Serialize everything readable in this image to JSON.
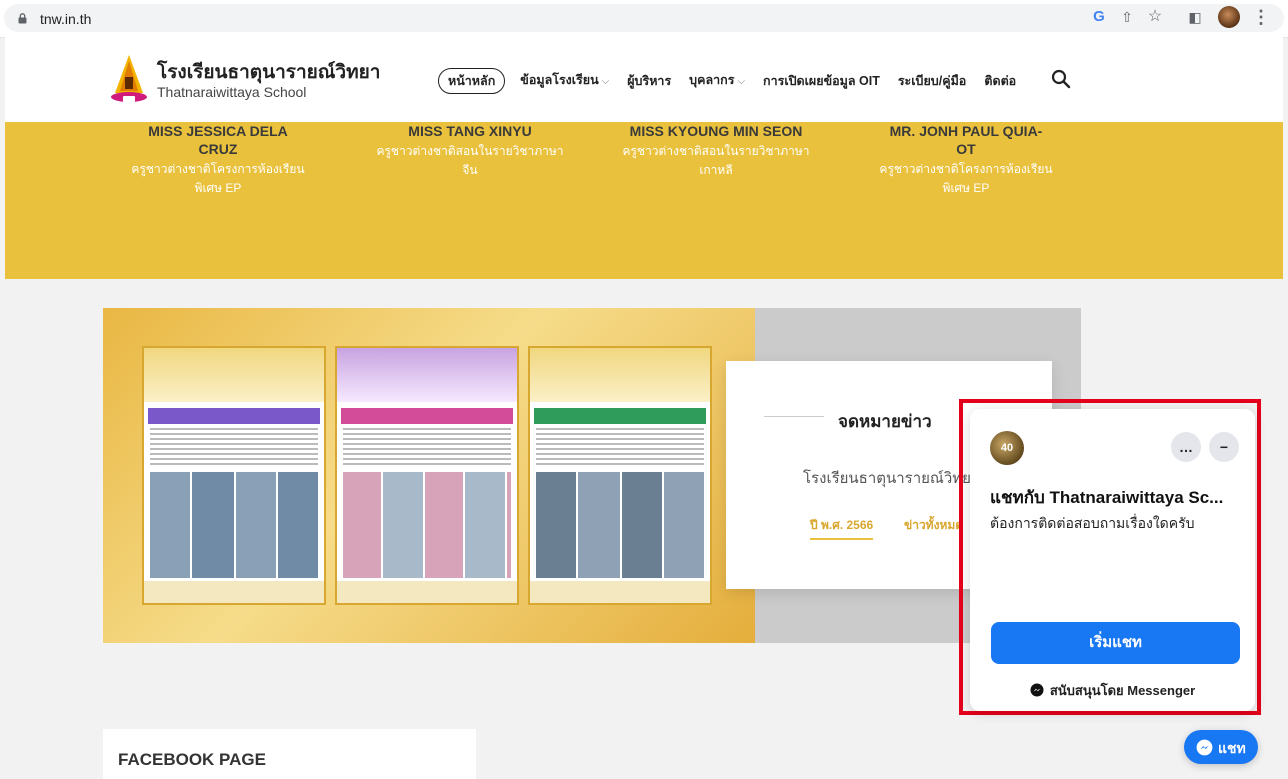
{
  "browser": {
    "url": "tnw.in.th",
    "icons": [
      "lock-icon",
      "google-icon",
      "share-icon",
      "star-icon",
      "sidebar-icon",
      "profile-avatar",
      "kebab-icon"
    ]
  },
  "header": {
    "school_th": "โรงเรียนธาตุนารายณ์วิทยา",
    "school_en": "Thatnaraiwittaya School",
    "nav": [
      {
        "label": "หน้าหลัก",
        "active": true
      },
      {
        "label": "ข้อมูลโรงเรียน",
        "dropdown": true
      },
      {
        "label": "ผู้บริหาร"
      },
      {
        "label": "บุคลากร",
        "dropdown": true
      },
      {
        "label": "การเปิดเผยข้อมูล OIT"
      },
      {
        "label": "ระเบียบ/คู่มือ"
      },
      {
        "label": "ติดต่อ"
      }
    ],
    "dropdown_glyph": "⌵"
  },
  "staff": [
    {
      "name1": "MISS JESSICA DELA",
      "name2": "CRUZ",
      "role1": "ครูชาวต่างชาติโครงการห้องเรียน",
      "role2": "พิเศษ EP"
    },
    {
      "name1": "MISS TANG XINYU",
      "name2": "",
      "role1": "ครูชาวต่างชาติสอนในรายวิชาภาษา",
      "role2": "จีน"
    },
    {
      "name1": "MISS KYOUNG MIN SEON",
      "name2": "",
      "role1": "ครูชาวต่างชาติสอนในรายวิชาภาษา",
      "role2": "เกาหลี"
    },
    {
      "name1": "MR. JONH PAUL QUIA-",
      "name2": "OT",
      "role1": "ครูชาวต่างชาติโครงการห้องเรียน",
      "role2": "พิเศษ EP"
    }
  ],
  "newsletter": {
    "title": "จดหมายข่าว",
    "school": "โรงเรียนธาตุนารายณ์วิทยา",
    "year_tab": "ปี พ.ศ. 2566",
    "all_tab": "ข่าวทั้งหมด"
  },
  "facebook": {
    "title": "FACEBOOK PAGE"
  },
  "chat": {
    "avatar_text": "40",
    "more": "…",
    "minimize": "−",
    "title": "แชทกับ Thatnaraiwittaya Sc...",
    "greeting": "ต้องการติดต่อสอบถามเรื่องใดครับ",
    "start_button": "เริ่มแชท",
    "powered_by": "สนับสนุนโดย Messenger",
    "bubble_label": "แชท",
    "highlight_color": "#e4001b",
    "button_color": "#1877f2"
  },
  "colors": {
    "band": "#e9c13c",
    "accent_gold": "#d8a72f"
  }
}
